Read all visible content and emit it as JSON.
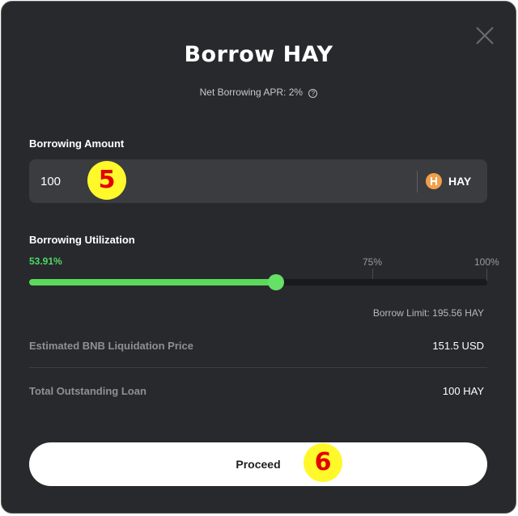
{
  "modal": {
    "title": "Borrow HAY",
    "apr_label": "Net Borrowing APR:",
    "apr_value": "2%",
    "close_icon": "close-icon",
    "info_icon": "info-icon"
  },
  "borrow_amount": {
    "label": "Borrowing Amount",
    "value": "100",
    "token": "HAY",
    "token_icon": "hay-token-icon"
  },
  "utilization": {
    "label": "Borrowing Utilization",
    "current_percent_label": "53.91%",
    "current_percent": 53.91,
    "tick_75": "75%",
    "tick_100": "100%",
    "fill_color": "#5ad95b",
    "borrow_limit": "Borrow Limit: 195.56 HAY"
  },
  "details": {
    "liquidation_label": "Estimated BNB Liquidation Price",
    "liquidation_value": "151.5 USD",
    "loan_label": "Total Outstanding Loan",
    "loan_value": "100 HAY"
  },
  "actions": {
    "proceed_label": "Proceed"
  },
  "annotations": {
    "step_5": "5",
    "step_6": "6",
    "badge_color": "#fff82a",
    "badge_text_color": "#e30000"
  }
}
